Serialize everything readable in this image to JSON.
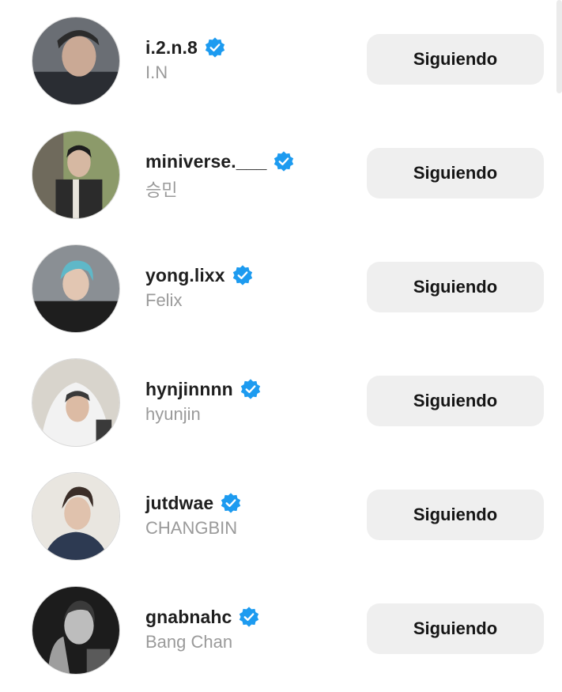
{
  "following": [
    {
      "handle": "i.2.n.8",
      "name": "I.N",
      "button": "Siguiendo",
      "avatar_colors": [
        "#5a5f66",
        "#c9b8a8",
        "#2a2d33"
      ]
    },
    {
      "handle": "miniverse.___",
      "name": "승민",
      "button": "Siguiendo",
      "avatar_colors": [
        "#7e8c5c",
        "#2b2b2b",
        "#e8e4dc"
      ]
    },
    {
      "handle": "yong.lixx",
      "name": "Felix",
      "button": "Siguiendo",
      "avatar_colors": [
        "#8a8f94",
        "#5fb8c8",
        "#1e1e1e"
      ]
    },
    {
      "handle": "hynjinnnn",
      "name": "hyunjin",
      "button": "Siguiendo",
      "avatar_colors": [
        "#d8d4cc",
        "#f2f2f2",
        "#3a3a3a"
      ]
    },
    {
      "handle": "jutdwae",
      "name": "CHANGBIN",
      "button": "Siguiendo",
      "avatar_colors": [
        "#e9e6e0",
        "#2d3a52",
        "#3b2e28"
      ]
    },
    {
      "handle": "gnabnahc",
      "name": "Bang Chan",
      "button": "Siguiendo",
      "avatar_colors": [
        "#1c1c1c",
        "#bdbdbd",
        "#5a5a5a"
      ]
    }
  ],
  "verified_color": "#1d9bf0"
}
